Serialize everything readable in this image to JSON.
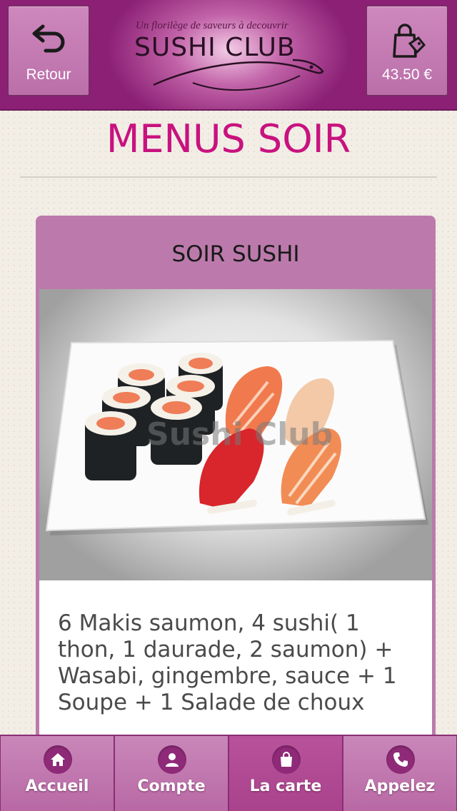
{
  "header": {
    "back_label": "Retour",
    "cart_total": "43.50 €",
    "logo_tagline": "Un florilège de saveurs à decouvrir",
    "logo_name": "SUSHI CLUB"
  },
  "page_title": "MENUS SOIR",
  "card": {
    "title": "SOIR SUSHI",
    "photo_watermark": "Sushi Club",
    "description": "6 Makis saumon, 4 sushi( 1 thon, 1 daurade, 2 saumon) + Wasabi, gingembre, sauce + 1 Soupe + 1 Salade de choux"
  },
  "bottom_nav": [
    {
      "label": "Accueil",
      "icon": "home-icon"
    },
    {
      "label": "Compte",
      "icon": "user-icon"
    },
    {
      "label": "La carte",
      "icon": "shopping-bag-icon",
      "active": true
    },
    {
      "label": "Appelez",
      "icon": "phone-icon"
    }
  ],
  "colors": {
    "header": "#8c2075",
    "accent": "#c8127f",
    "card": "#bc7aac",
    "nav": "#bf76ad"
  }
}
